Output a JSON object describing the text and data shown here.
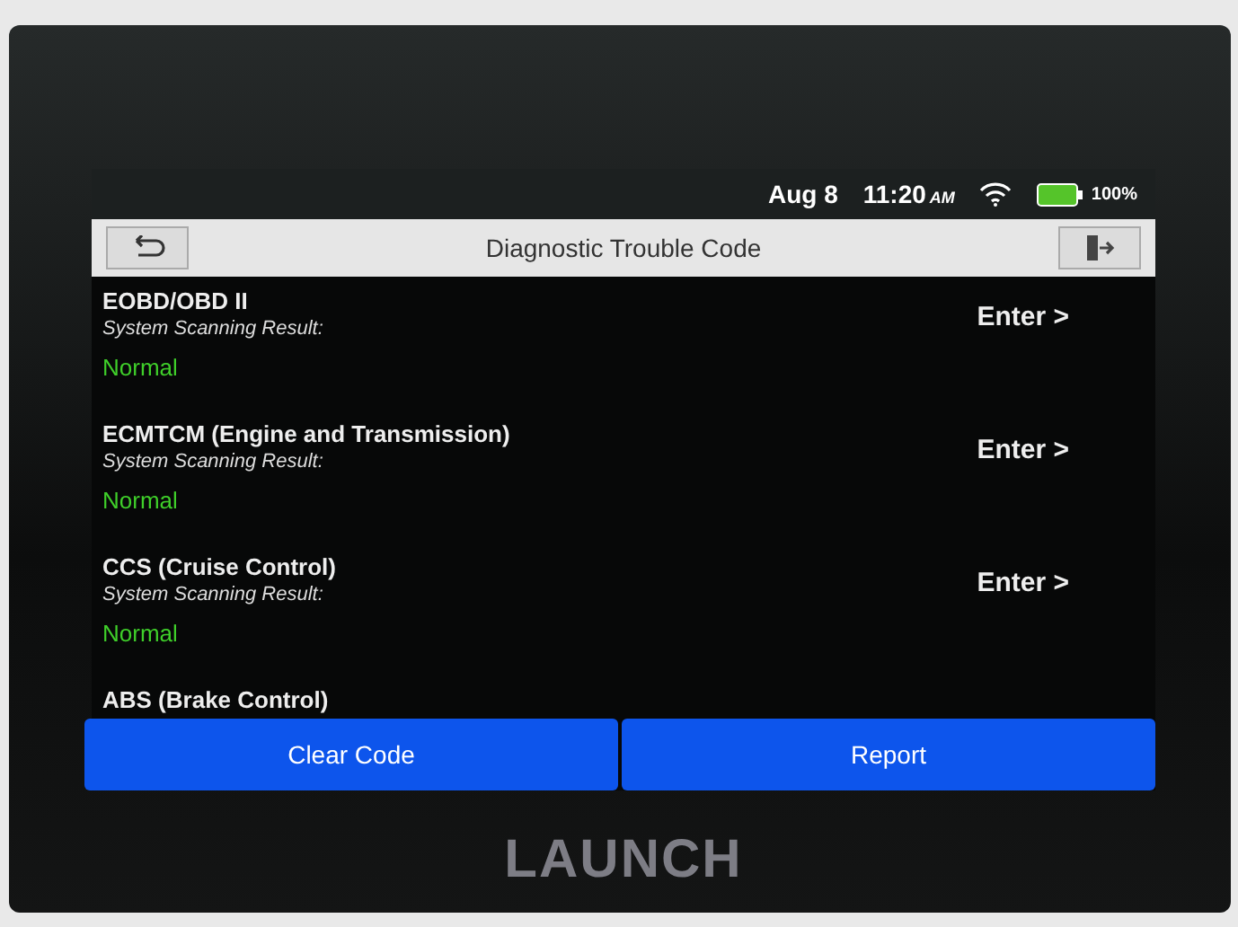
{
  "status_bar": {
    "date": "Aug 8",
    "time": "11:20",
    "meridiem": "AM",
    "battery": "100%"
  },
  "title_bar": {
    "title": "Diagnostic Trouble Code"
  },
  "systems": [
    {
      "name": "EOBD/OBD II",
      "caption": "System Scanning Result:",
      "result": "Normal",
      "action": "Enter >"
    },
    {
      "name": "ECMTCM (Engine and Transmission)",
      "caption": "System Scanning Result:",
      "result": "Normal",
      "action": "Enter >"
    },
    {
      "name": "CCS (Cruise Control)",
      "caption": "System Scanning Result:",
      "result": "Normal",
      "action": "Enter >"
    },
    {
      "name": "ABS (Brake Control)"
    }
  ],
  "buttons": [
    "Clear Code",
    "Report"
  ],
  "brand": "LAUNCH"
}
